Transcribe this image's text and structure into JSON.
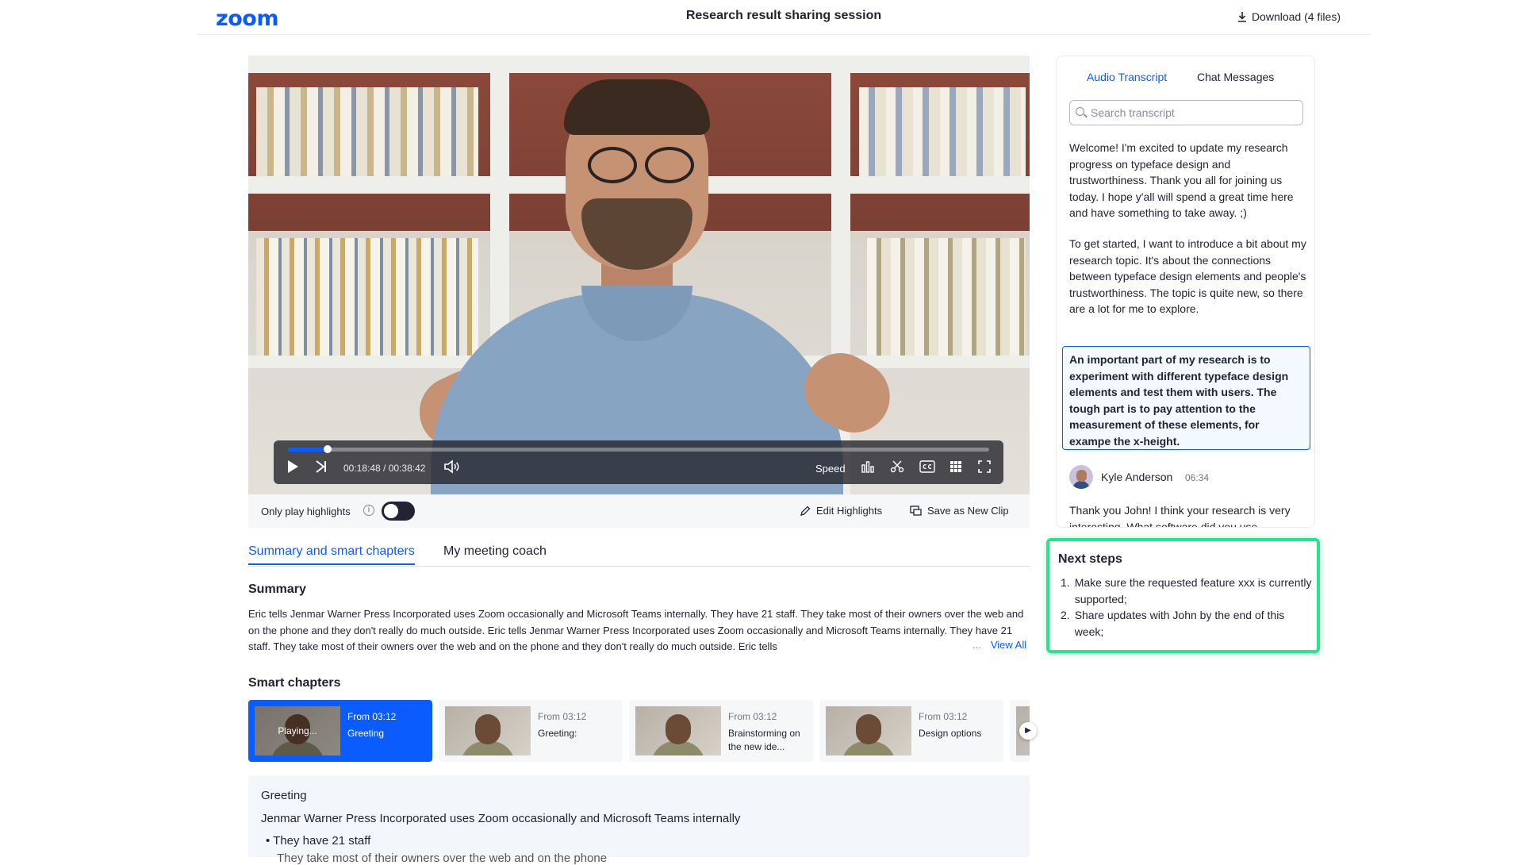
{
  "header": {
    "logo": "zoom",
    "title": "Research result sharing session",
    "download_label": "Download (4 files)"
  },
  "player": {
    "time": "00:18:48 / 00:38:42",
    "progress_fraction": 0.057,
    "speed_label": "Speed"
  },
  "highlights_bar": {
    "only_play_label": "Only play highlights",
    "toggle_on": false,
    "edit_label": "Edit Highlights",
    "save_clip_label": "Save as New Clip"
  },
  "tabs": [
    {
      "label": "Summary and smart chapters",
      "active": true
    },
    {
      "label": "My meeting coach",
      "active": false
    }
  ],
  "summary": {
    "heading": "Summary",
    "text": "Eric tells Jenmar Warner Press Incorporated uses Zoom occasionally and Microsoft Teams internally. They have 21 staff. They take most of their owners over the web and on the phone and they don't really do much outside. Eric tells Jenmar Warner Press Incorporated uses Zoom occasionally and Microsoft Teams internally. They have 21 staff. They take most of their owners over the web and on the phone and they don't really do much outside. Eric tells",
    "ellipsis": "...",
    "view_all": "View All"
  },
  "smart_chapters": {
    "heading": "Smart chapters",
    "items": [
      {
        "from": "From 03:12",
        "title": "Greeting",
        "playing": "Playing...",
        "active": true
      },
      {
        "from": "From 03:12",
        "title": "Greeting:",
        "active": false
      },
      {
        "from": "From 03:12",
        "title": "Brainstorming on the new ide...",
        "active": false
      },
      {
        "from": "From 03:12",
        "title": "Design options",
        "active": false
      }
    ]
  },
  "chapter_detail": {
    "title": "Greeting",
    "text": "Jenmar Warner Press Incorporated uses Zoom occasionally and Microsoft Teams internally",
    "bullets": [
      "They have 21 staff",
      "They take most of their owners over the web and on the phone"
    ]
  },
  "transcript_panel": {
    "tabs": [
      {
        "label": "Audio Transcript",
        "active": true
      },
      {
        "label": "Chat Messages",
        "active": false
      }
    ],
    "search_placeholder": "Search transcript",
    "paragraphs": [
      "Welcome! I'm excited to update my research progress on typeface design and trustworthiness. Thank you all for joining us today. I hope y'all will spend a great time here and have something to take away. ;)",
      "To get started, I want to introduce a bit about my research topic. It's about the connections between typeface design elements and people's trustworthiness. The topic is quite new, so there are a lot for me to explore."
    ],
    "highlighted": "An important part of my research is to experiment with different typeface design elements and test them with users. The tough part is to pay attention to the measurement of these elements, for exampe the x-height.",
    "speaker": {
      "name": "Kyle Anderson",
      "time": "06:34"
    },
    "reply": "Thank you John! I think your research is very interesting. What software did you use"
  },
  "next_steps": {
    "title": "Next steps",
    "items": [
      "Make sure the requested feature xxx is currently supported;",
      "Share updates with John by the end of this week;"
    ]
  },
  "colors": {
    "accent": "#0b5cff",
    "highlight_border": "#28e48a"
  }
}
